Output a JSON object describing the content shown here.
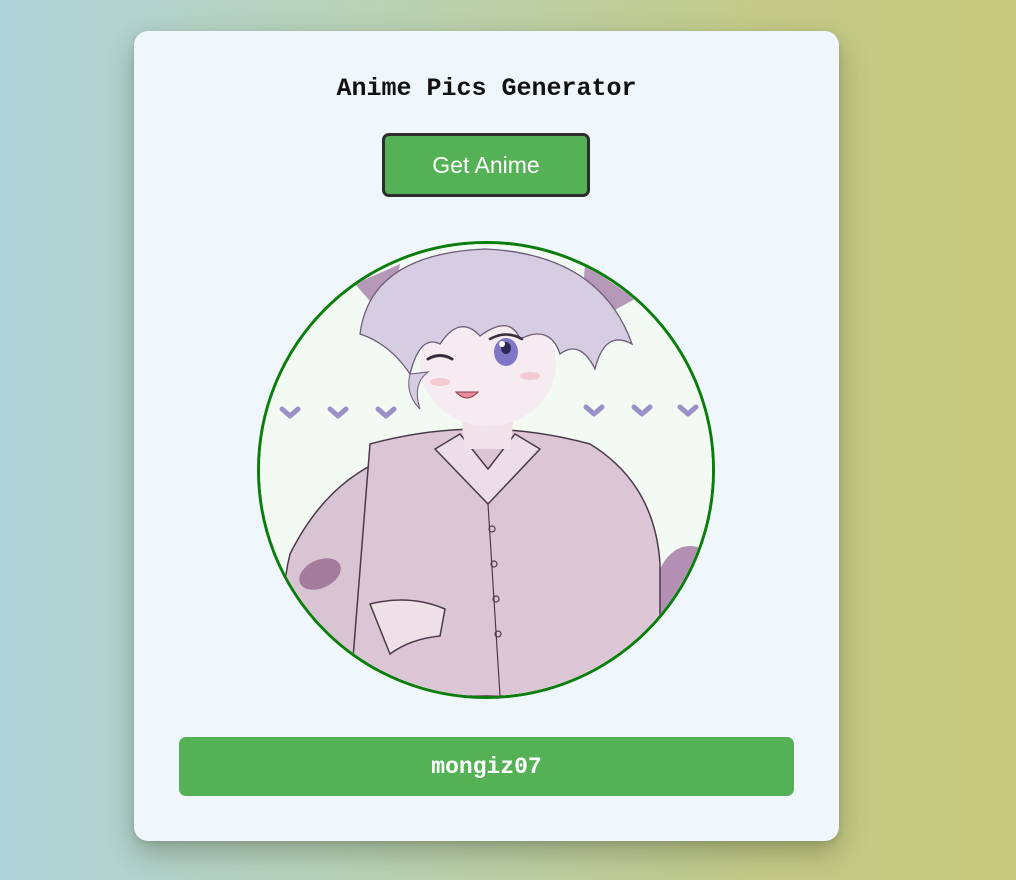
{
  "app": {
    "title": "Anime Pics Generator"
  },
  "controls": {
    "get_button_label": "Get Anime"
  },
  "image": {
    "description_icon": "anime-character-image"
  },
  "footer": {
    "username": "mongiz07"
  },
  "colors": {
    "accent_green": "#54b155",
    "image_border": "#0a7d0a",
    "card_background": "#eff7fd"
  }
}
